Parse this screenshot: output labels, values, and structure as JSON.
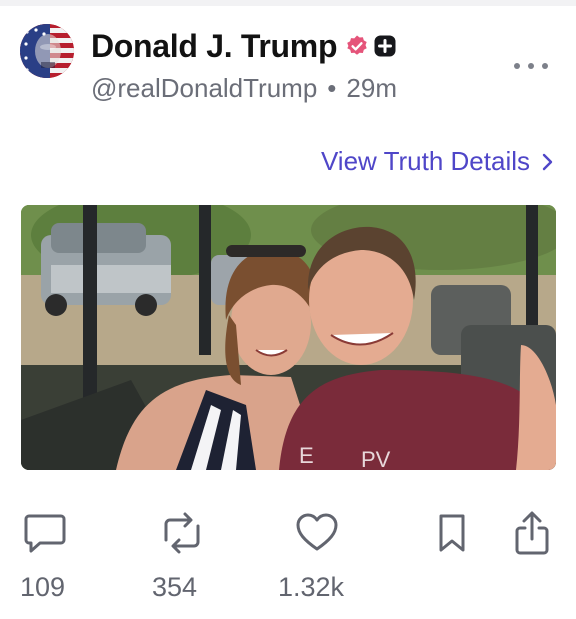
{
  "post": {
    "author": {
      "display_name": "Donald J. Trump",
      "handle": "@realDonaldTrump",
      "avatar_icon": "american-flag-portrait",
      "verified_icon": "verified-badge-icon",
      "plus_icon": "plus-badge-icon",
      "verified_color": "#e5547a"
    },
    "separator": "•",
    "time_ago": "29m",
    "view_details_label": "View Truth Details",
    "view_details_chevron": "›",
    "link_color": "#4f46c8",
    "media": {
      "type": "photo",
      "subject": "selfie-couple-in-safari-vehicle"
    }
  },
  "actions": {
    "reply": {
      "icon": "comment-icon",
      "count": "109"
    },
    "retruth": {
      "icon": "repost-icon",
      "count": "354"
    },
    "like": {
      "icon": "heart-icon",
      "count": "1.32k"
    },
    "bookmark": {
      "icon": "bookmark-icon"
    },
    "share": {
      "icon": "share-icon"
    }
  }
}
